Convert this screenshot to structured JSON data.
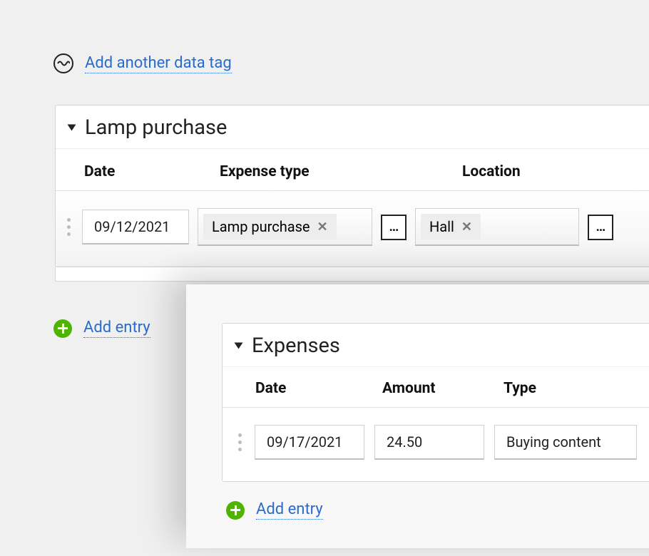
{
  "topLink": {
    "label": "Add another data tag"
  },
  "panel1": {
    "title": "Lamp purchase",
    "headers": {
      "date": "Date",
      "type": "Expense type",
      "location": "Location"
    },
    "row": {
      "date": "09/12/2021",
      "typeTag": "Lamp purchase",
      "locationTag": "Hall"
    },
    "dotsLabel": "..."
  },
  "addEntry1": {
    "label": "Add entry"
  },
  "panel2": {
    "title": "Expenses",
    "headers": {
      "date": "Date",
      "amount": "Amount",
      "type": "Type"
    },
    "row": {
      "date": "09/17/2021",
      "amount": "24.50",
      "type": "Buying content"
    }
  },
  "addEntry2": {
    "label": "Add entry"
  }
}
